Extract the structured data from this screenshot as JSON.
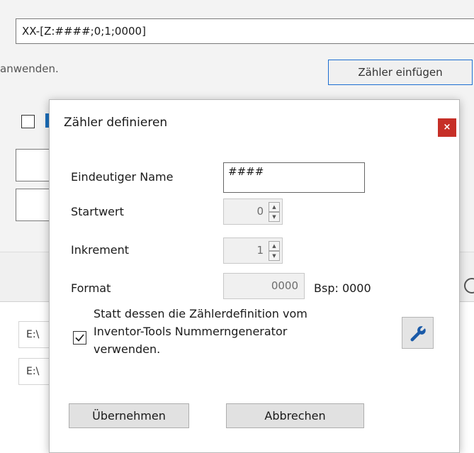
{
  "background": {
    "pattern_value": "XX-[Z:####;0;1;0000]",
    "hint_text": "anwenden.",
    "insert_counter_label": "Zähler einfügen",
    "table_rows": [
      "E:\\",
      "E:\\"
    ]
  },
  "dialog": {
    "title": "Zähler definieren",
    "close_glyph": "×",
    "unique_name_label": "Eindeutiger Name",
    "unique_name_value": "####",
    "start_label": "Startwert",
    "start_value": "0",
    "increment_label": "Inkrement",
    "increment_value": "1",
    "format_label": "Format",
    "format_value": "0000",
    "format_example": "Bsp: 0000",
    "use_generator_checked": true,
    "use_generator_text": "Statt dessen die Zählerdefinition vom Inventor-Tools Nummerngenerator verwenden.",
    "wrench_icon": "wrench-icon",
    "apply_label": "Übernehmen",
    "cancel_label": "Abbrechen"
  },
  "colors": {
    "accent_border": "#1c6ed1",
    "close_button": "#c62f27",
    "wrench": "#1a5aa8"
  }
}
